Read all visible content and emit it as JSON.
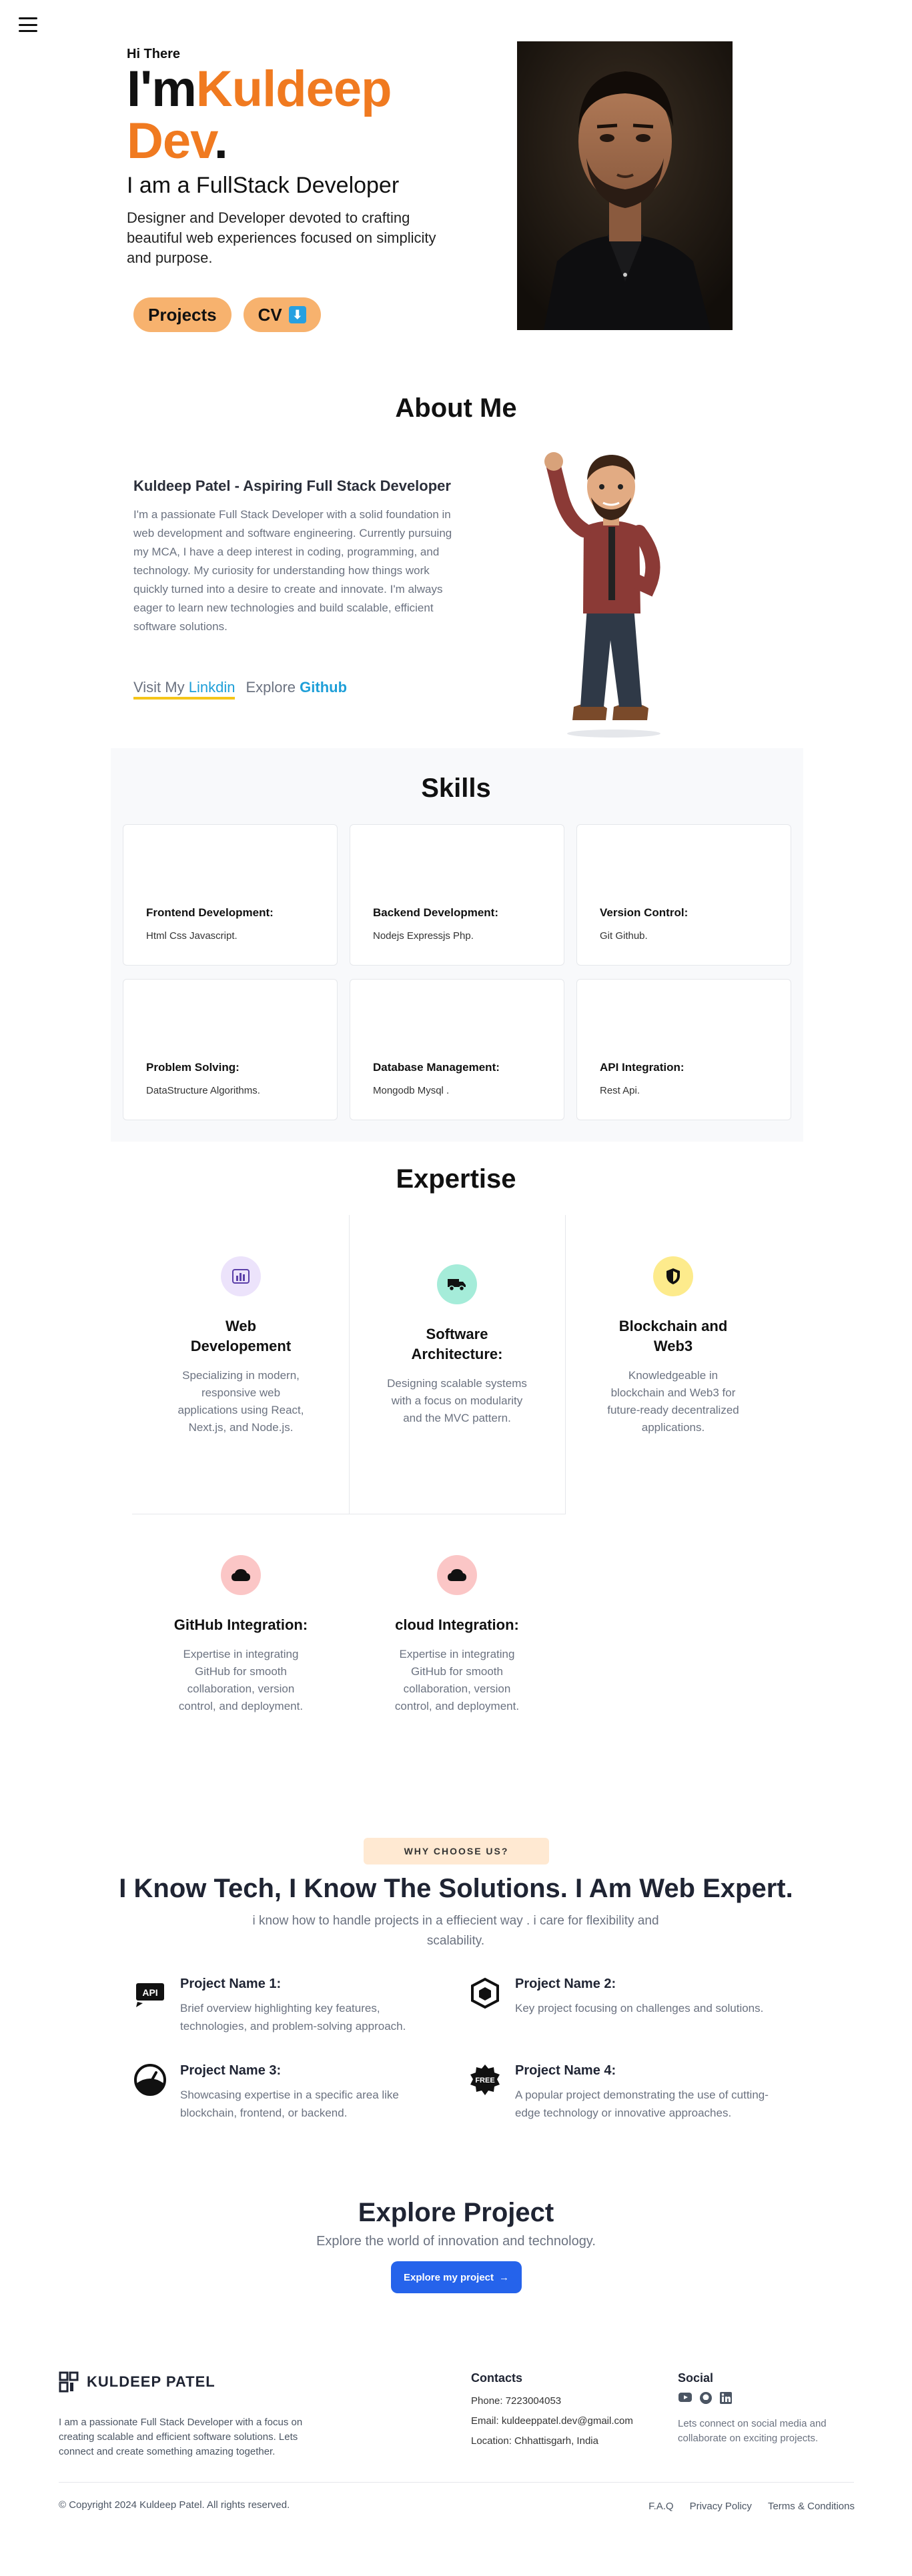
{
  "hero": {
    "greeting": "Hi There",
    "im": "I'm",
    "name_orange_1": "Kuldeep",
    "name_orange_2": "Dev",
    "dot": ".",
    "role": "I am a FullStack Developer",
    "description": "Designer and Developer devoted to crafting beautiful web experiences focused on simplicity and purpose.",
    "projects_button": "Projects",
    "cv_button": "CV",
    "cv_icon": "⬇"
  },
  "about": {
    "title": "About Me",
    "heading": "Kuldeep Patel - Aspiring Full Stack Developer",
    "body": "I'm a passionate Full Stack Developer with a solid foundation in web development and software engineering. Currently pursuing my MCA, I have a deep interest in coding, programming, and technology. My curiosity for understanding how things work quickly turned into a desire to create and innovate. I'm always eager to learn new technologies and build scalable, efficient software solutions.",
    "visit_prefix": "Visit My ",
    "visit_link": "Linkdin",
    "explore_prefix": "Explore ",
    "explore_link": "Github"
  },
  "skills": {
    "title": "Skills",
    "cards": [
      {
        "title": "Frontend Development:",
        "text": "Html Css Javascript."
      },
      {
        "title": "Backend Development:",
        "text": "Nodejs Expressjs Php."
      },
      {
        "title": "Version Control:",
        "text": "Git Github."
      },
      {
        "title": "Problem Solving:",
        "text": "DataStructure Algorithms."
      },
      {
        "title": "Database Management:",
        "text": "Mongodb Mysql ."
      },
      {
        "title": "API Integration:",
        "text": "Rest Api."
      }
    ]
  },
  "expertise": {
    "title": "Expertise",
    "items": [
      {
        "title": "Web Developement",
        "text": "Specializing in modern, responsive web applications using React, Next.js, and Node.js.",
        "icon": "chart-icon",
        "color": "#ece3fb"
      },
      {
        "title": "Software Architecture:",
        "text": "Designing scalable systems with a focus on modularity and the MVC pattern.",
        "icon": "truck-icon",
        "color": "#a5ecd9"
      },
      {
        "title": "Blockchain and Web3",
        "text": "Knowledgeable in blockchain and Web3 for future-ready decentralized applications.",
        "icon": "shield-icon",
        "color": "#fdeb8c"
      },
      {
        "title": "GitHub Integration:",
        "text": "Expertise in integrating GitHub for smooth collaboration, version control, and deployment.",
        "icon": "cloud-icon",
        "color": "#fbc6c6"
      },
      {
        "title": "cloud Integration:",
        "text": "Expertise in integrating GitHub for smooth collaboration, version control, and deployment.",
        "icon": "cloud-icon",
        "color": "#fbc6c6"
      }
    ]
  },
  "why": {
    "badge": "WHY CHOOSE US?",
    "title": "I Know Tech, I Know The Solutions. I Am Web Expert.",
    "subtitle": "i know how to handle projects in a effiecient way . i care for flexibility and scalability.",
    "projects": [
      {
        "title": "Project Name 1:",
        "text": "Brief overview highlighting key features, technologies, and problem-solving approach.",
        "icon": "api-icon"
      },
      {
        "title": "Project Name 2:",
        "text": "Key project focusing on challenges and solutions.",
        "icon": "cube-icon"
      },
      {
        "title": "Project Name 3:",
        "text": "Showcasing expertise in a specific area like blockchain, frontend, or backend.",
        "icon": "gauge-icon"
      },
      {
        "title": "Project Name 4:",
        "text": "A popular project demonstrating the use of cutting-edge technology or innovative approaches.",
        "icon": "free-badge-icon",
        "badge_text": "FREE"
      }
    ]
  },
  "explore": {
    "title": "Explore Project",
    "subtitle": "Explore the world of innovation and technology.",
    "button": "Explore my project",
    "button_arrow": "→"
  },
  "footer": {
    "brand": "KULDEEP PATEL",
    "about": "I am a passionate Full Stack Developer with a focus on creating scalable and efficient software solutions. Lets connect and create something amazing together.",
    "contacts_title": "Contacts",
    "phone": "Phone: 7223004053",
    "email": "Email: kuldeeppatel.dev@gmail.com",
    "location": "Location: Chhattisgarh, India",
    "social_title": "Social",
    "social_text": "Lets connect on social media and collaborate on exciting projects.",
    "copyright": "© Copyright 2024 Kuldeep Patel. All rights reserved.",
    "links": [
      "F.A.Q",
      "Privacy Policy",
      "Terms & Conditions"
    ]
  },
  "colors": {
    "accent_orange": "#f07a20",
    "button_peach": "#f7b26e",
    "link_blue": "#1e9fd8",
    "primary_blue": "#2563eb"
  }
}
